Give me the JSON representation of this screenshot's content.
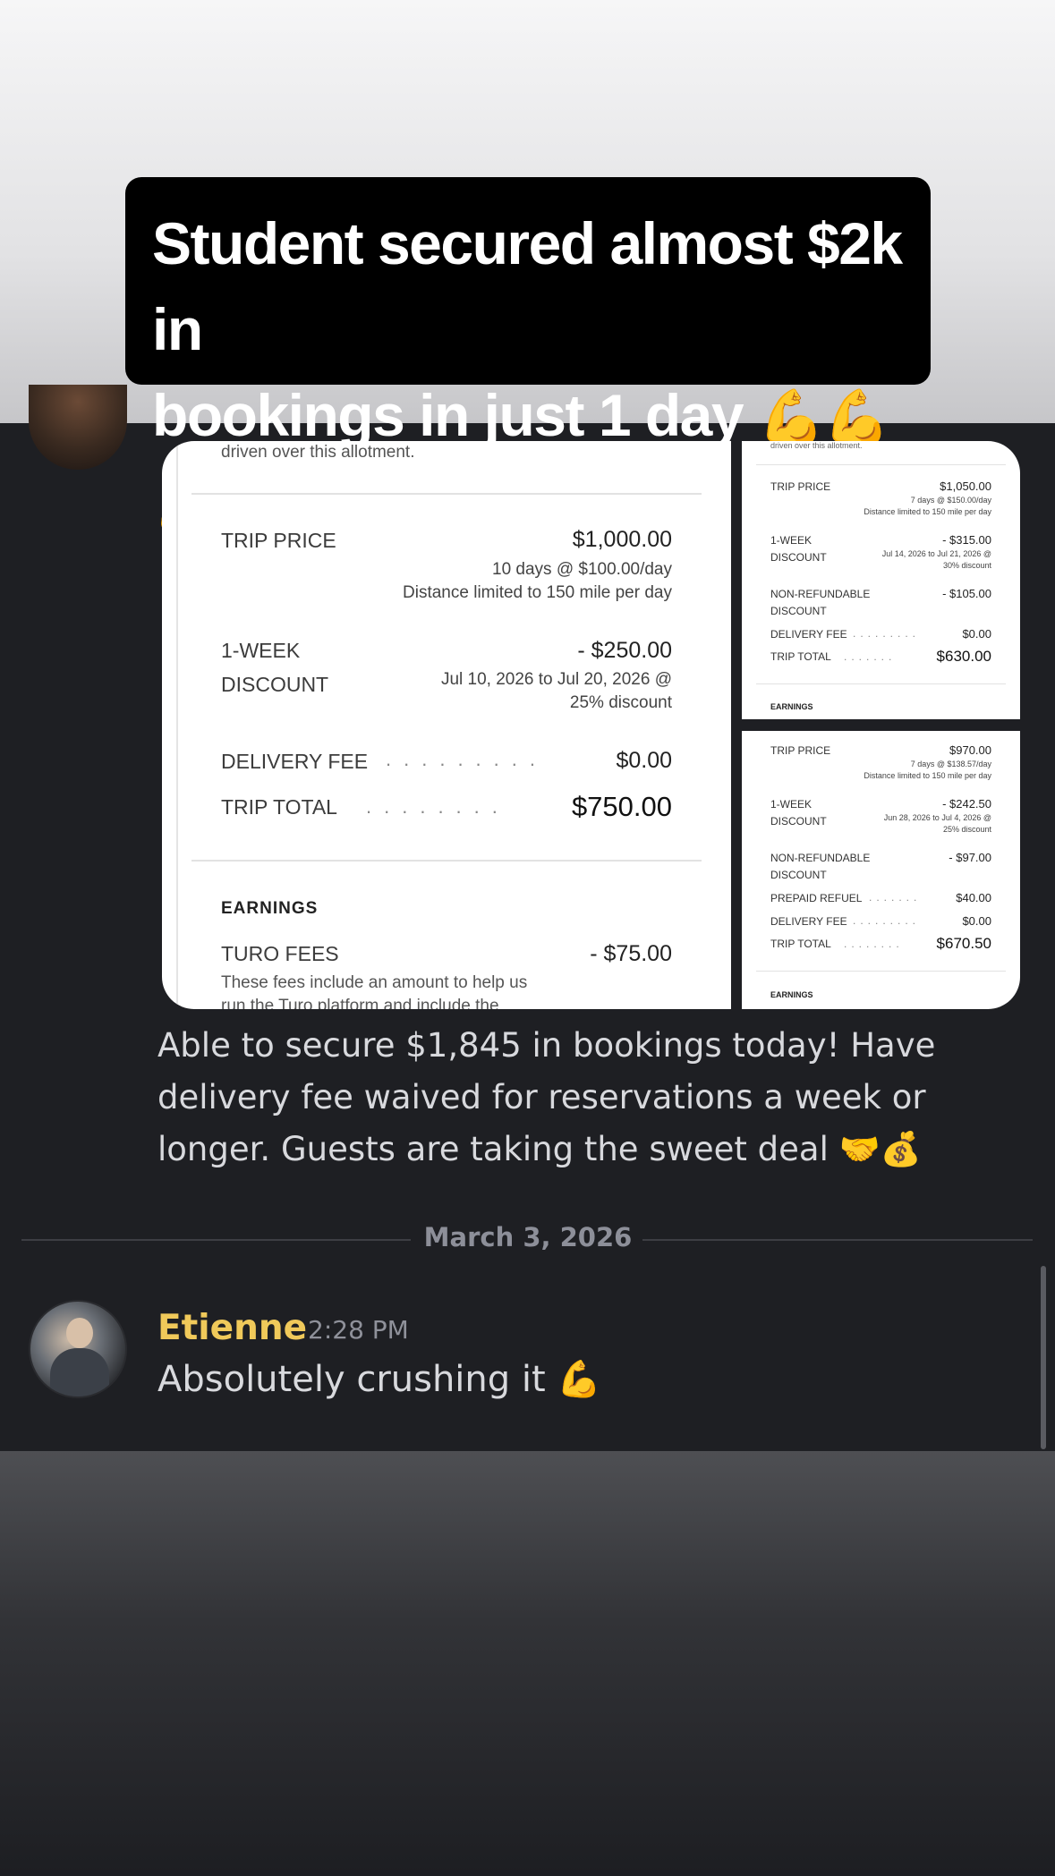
{
  "caption": {
    "line1": "Student secured almost $2k in",
    "line2": "bookings in just 1 day",
    "emoji": "💪💪💪"
  },
  "receipt_main": {
    "header_text": "driven over this allotment.",
    "trip_price_label": "TRIP PRICE",
    "trip_price": "$1,000.00",
    "trip_price_detail1": "10 days @ $100.00/day",
    "trip_price_detail2": "Distance limited to 150 mile per day",
    "discount_label1": "1-WEEK",
    "discount_label2": "DISCOUNT",
    "discount_amount": "- $250.00",
    "discount_detail1": "Jul 10, 2026 to Jul 20, 2026 @",
    "discount_detail2": "25% discount",
    "delivery_label": "DELIVERY FEE",
    "delivery_amount": "$0.00",
    "total_label": "TRIP TOTAL",
    "total_amount": "$750.00",
    "earnings_label": "EARNINGS",
    "turo_label": "TURO FEES",
    "turo_amount": "- $75.00",
    "turo_note1": "These fees include an amount to help us",
    "turo_note2": "run the Turo platform and include the"
  },
  "receipt_top_right": {
    "header_text": "driven over this allotment.",
    "trip_price_label": "TRIP PRICE",
    "trip_price": "$1,050.00",
    "trip_price_detail1": "7 days @ $150.00/day",
    "trip_price_detail2": "Distance limited to 150 mile per day",
    "discount_label1": "1-WEEK",
    "discount_label2": "DISCOUNT",
    "discount_amount": "- $315.00",
    "discount_detail1": "Jul 14, 2026 to Jul 21, 2026 @",
    "discount_detail2": "30% discount",
    "nonref_label1": "NON-REFUNDABLE",
    "nonref_label2": "DISCOUNT",
    "nonref_amount": "- $105.00",
    "delivery_label": "DELIVERY FEE",
    "delivery_amount": "$0.00",
    "total_label": "TRIP TOTAL",
    "total_amount": "$630.00",
    "earnings_label": "EARNINGS"
  },
  "receipt_bottom_right": {
    "trip_price_label": "TRIP PRICE",
    "trip_price": "$970.00",
    "trip_price_detail1": "7 days @ $138.57/day",
    "trip_price_detail2": "Distance limited to 150 mile per day",
    "discount_label1": "1-WEEK",
    "discount_label2": "DISCOUNT",
    "discount_amount": "- $242.50",
    "discount_detail1": "Jun 28, 2026 to Jul 4, 2026 @",
    "discount_detail2": "25% discount",
    "nonref_label1": "NON-REFUNDABLE",
    "nonref_label2": "DISCOUNT",
    "nonref_amount": "- $97.00",
    "refuel_label": "PREPAID REFUEL",
    "refuel_amount": "$40.00",
    "delivery_label": "DELIVERY FEE",
    "delivery_amount": "$0.00",
    "total_label": "TRIP TOTAL",
    "total_amount": "$670.50",
    "earnings_label": "EARNINGS"
  },
  "message": {
    "text": "Able to secure $1,845 in bookings today! Have delivery fee waived for reservations a week or longer. Guests are taking the sweet deal 🤝💰"
  },
  "date_divider": "March 3, 2026",
  "reply": {
    "author": "Etienne",
    "time": "2:28 PM",
    "text": "Absolutely crushing it 💪"
  },
  "colors": {
    "background": "#1e1f23",
    "author_name": "#f0c95a",
    "discount_red": "#9b2a2a",
    "caption_bg": "#000000"
  }
}
